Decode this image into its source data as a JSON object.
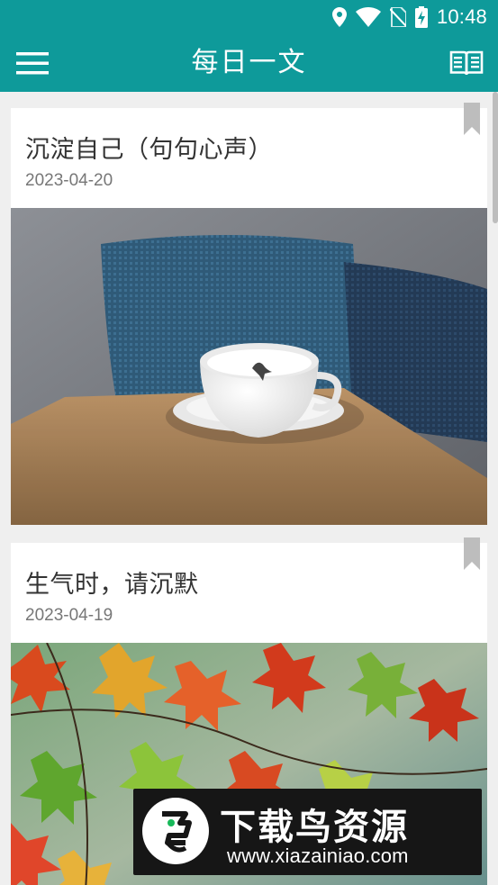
{
  "status_bar": {
    "time": "10:48",
    "icons": [
      "location-icon",
      "wifi-icon",
      "no-sim-icon",
      "battery-charging-icon"
    ]
  },
  "app_bar": {
    "title": "每日一文",
    "left_icon": "menu-icon",
    "right_icon": "book-icon"
  },
  "articles": [
    {
      "title": "沉淀自己（句句心声）",
      "date": "2023-04-20",
      "image": "coffee-cup-photo",
      "bookmark_icon": "bookmark-icon"
    },
    {
      "title": "生气时，请沉默",
      "date": "2023-04-19",
      "image": "maple-leaves-photo",
      "bookmark_icon": "bookmark-icon"
    }
  ],
  "watermark": {
    "title": "下载鸟资源",
    "url": "www.xiazainiao.com"
  },
  "colors": {
    "primary": "#0e9a9a",
    "background": "#efefef",
    "card": "#ffffff",
    "title_text": "#333333",
    "date_text": "#777777"
  }
}
